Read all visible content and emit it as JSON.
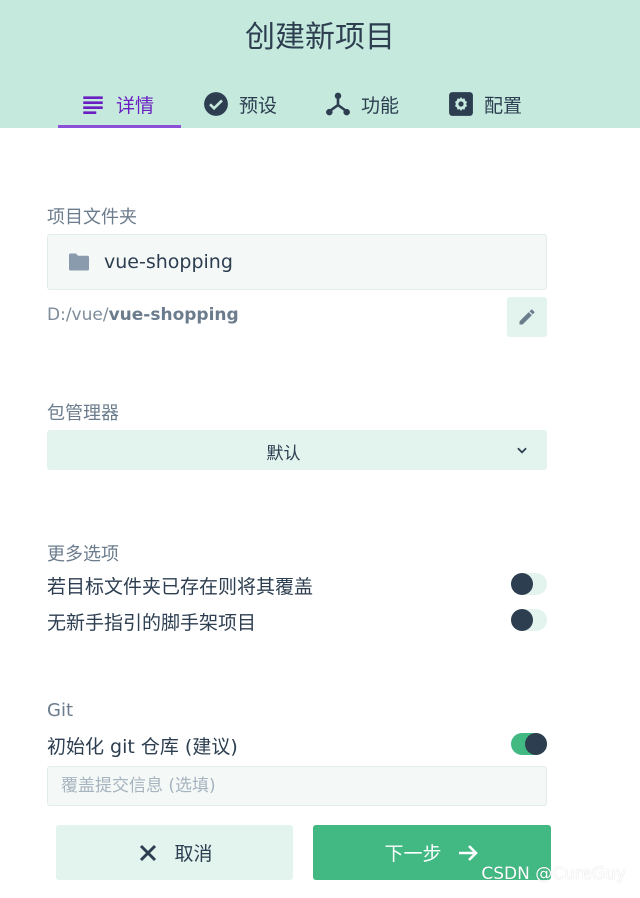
{
  "title": "创建新项目",
  "tabs": [
    {
      "label": "详情",
      "icon": "list-icon",
      "active": true
    },
    {
      "label": "预设",
      "icon": "check-circle-icon",
      "active": false
    },
    {
      "label": "功能",
      "icon": "fork-icon",
      "active": false
    },
    {
      "label": "配置",
      "icon": "gear-icon",
      "active": false
    }
  ],
  "folder": {
    "label": "项目文件夹",
    "name": "vue-shopping",
    "path_prefix": "D:/vue/",
    "path_name": "vue-shopping"
  },
  "package_manager": {
    "label": "包管理器",
    "selected": "默认"
  },
  "more_options": {
    "label": "更多选项",
    "items": [
      {
        "label": "若目标文件夹已存在则将其覆盖",
        "enabled": false
      },
      {
        "label": "无新手指引的脚手架项目",
        "enabled": false
      }
    ]
  },
  "git": {
    "label": "Git",
    "init_label": "初始化 git 仓库 (建议)",
    "init_enabled": true,
    "commit_placeholder": "覆盖提交信息 (选填)",
    "commit_value": ""
  },
  "footer": {
    "cancel_label": "取消",
    "next_label": "下一步"
  },
  "watermark": "CSDN @CureGuy",
  "colors": {
    "header_bg": "#c6e9dd",
    "accent_green": "#42b983",
    "active_tab": "#6a1fc2",
    "text_dark": "#2c3e50"
  }
}
